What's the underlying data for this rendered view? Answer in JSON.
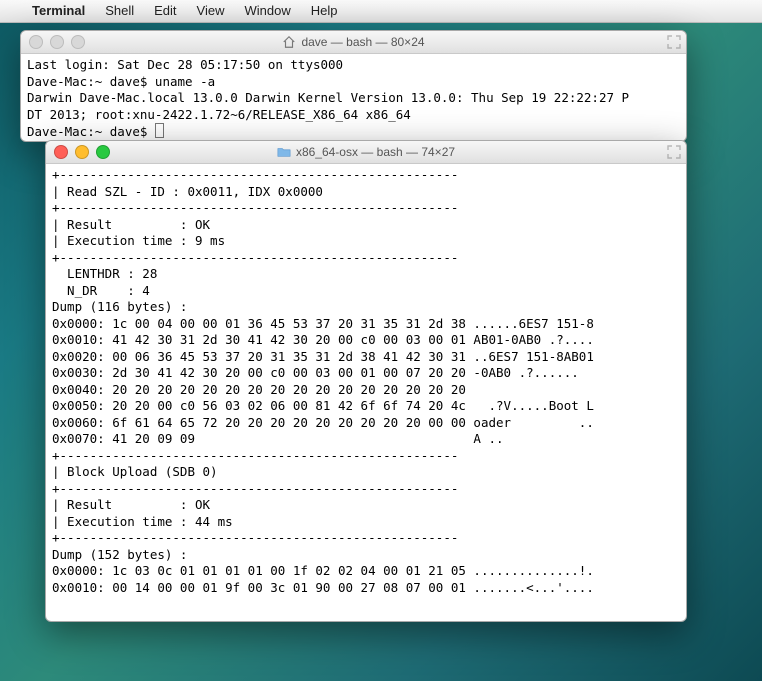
{
  "menubar": {
    "apple": "",
    "items": [
      "Terminal",
      "Shell",
      "Edit",
      "View",
      "Window",
      "Help"
    ]
  },
  "window1": {
    "title": "dave — bash — 80×24",
    "lines": [
      "Last login: Sat Dec 28 05:17:50 on ttys000",
      "Dave-Mac:~ dave$ uname -a",
      "Darwin Dave-Mac.local 13.0.0 Darwin Kernel Version 13.0.0: Thu Sep 19 22:22:27 P",
      "DT 2013; root:xnu-2422.1.72~6/RELEASE_X86_64 x86_64",
      "Dave-Mac:~ dave$ "
    ]
  },
  "window2": {
    "title": "x86_64-osx — bash — 74×27",
    "lines": [
      "+-----------------------------------------------------",
      "| Read SZL - ID : 0x0011, IDX 0x0000",
      "+-----------------------------------------------------",
      "| Result         : OK",
      "| Execution time : 9 ms",
      "+-----------------------------------------------------",
      "  LENTHDR : 28",
      "  N_DR    : 4",
      "Dump (116 bytes) :",
      "0x0000: 1c 00 04 00 00 01 36 45 53 37 20 31 35 31 2d 38 ......6ES7 151-8",
      "0x0010: 41 42 30 31 2d 30 41 42 30 20 00 c0 00 03 00 01 AB01-0AB0 .?....",
      "0x0020: 00 06 36 45 53 37 20 31 35 31 2d 38 41 42 30 31 ..6ES7 151-8AB01",
      "0x0030: 2d 30 41 42 30 20 00 c0 00 03 00 01 00 07 20 20 -0AB0 .?......  ",
      "0x0040: 20 20 20 20 20 20 20 20 20 20 20 20 20 20 20 20                 ",
      "0x0050: 20 20 00 c0 56 03 02 06 00 81 42 6f 6f 74 20 4c   .?V.....Boot L",
      "0x0060: 6f 61 64 65 72 20 20 20 20 20 20 20 20 20 00 00 oader         ..",
      "0x0070: 41 20 09 09                                     A ..            ",
      "",
      "+-----------------------------------------------------",
      "| Block Upload (SDB 0)",
      "+-----------------------------------------------------",
      "| Result         : OK",
      "| Execution time : 44 ms",
      "+-----------------------------------------------------",
      "Dump (152 bytes) :",
      "0x0000: 1c 03 0c 01 01 01 01 00 1f 02 02 04 00 01 21 05 ..............!.",
      "0x0010: 00 14 00 00 01 9f 00 3c 01 90 00 27 08 07 00 01 .......<...'...."
    ]
  }
}
